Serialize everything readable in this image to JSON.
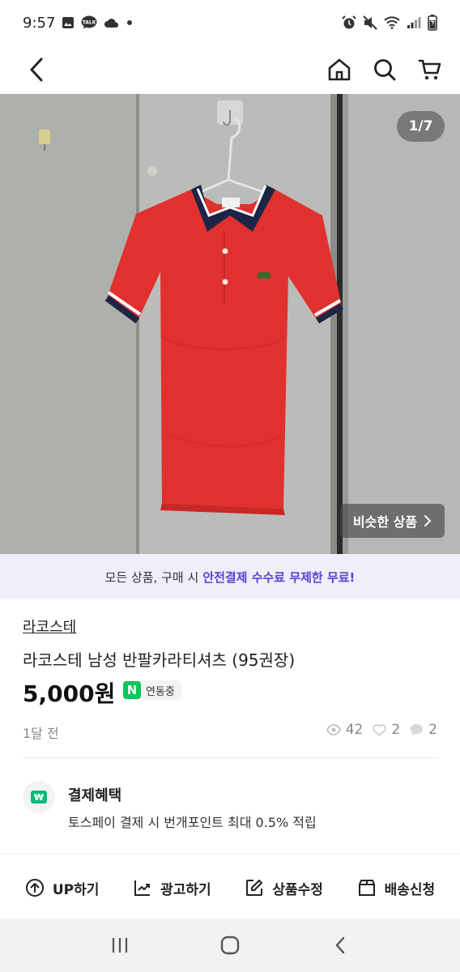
{
  "status_bar": {
    "time": "9:57",
    "left_icons": [
      "gallery-icon",
      "kakao-talk-icon",
      "cloud-icon",
      "dot-icon"
    ],
    "right_icons": [
      "alarm-icon",
      "mute-icon",
      "wifi-icon",
      "signal-icon",
      "battery-icon"
    ],
    "kakao_label": "TALK"
  },
  "nav": {
    "back_icon": "chevron-left-icon",
    "home_icon": "home-icon",
    "search_icon": "search-icon",
    "cart_icon": "cart-icon"
  },
  "photo": {
    "page_counter": "1/7",
    "similar_button": "비슷한 상품"
  },
  "promo": {
    "text": "모든 상품, 구매 시",
    "highlight": "안전결제 수수료 무제한 무료!",
    "highlight_color": "#5a40d6"
  },
  "product": {
    "brand": "라코스테",
    "title": "라코스테 남성 반팔카라티셔츠 (95권장)",
    "price": "5,000원",
    "naver_badge_letter": "N",
    "naver_badge_text": "연동중",
    "naver_color": "#03c75a",
    "time_ago": "1달 전",
    "views": "42",
    "likes": "2",
    "chats": "2"
  },
  "payment": {
    "title": "결제혜택",
    "description": "토스페이 결제 시 번개포인트 최대 0.5% 적립"
  },
  "actions": [
    {
      "label": "UP하기",
      "icon": "arrow-up-circle-icon"
    },
    {
      "label": "광고하기",
      "icon": "trend-chart-icon"
    },
    {
      "label": "상품수정",
      "icon": "edit-icon"
    },
    {
      "label": "배송신청",
      "icon": "box-icon"
    }
  ],
  "system_nav": {
    "recents_icon": "recents-icon",
    "home_icon": "home-circle-icon",
    "back_icon": "back-icon"
  }
}
